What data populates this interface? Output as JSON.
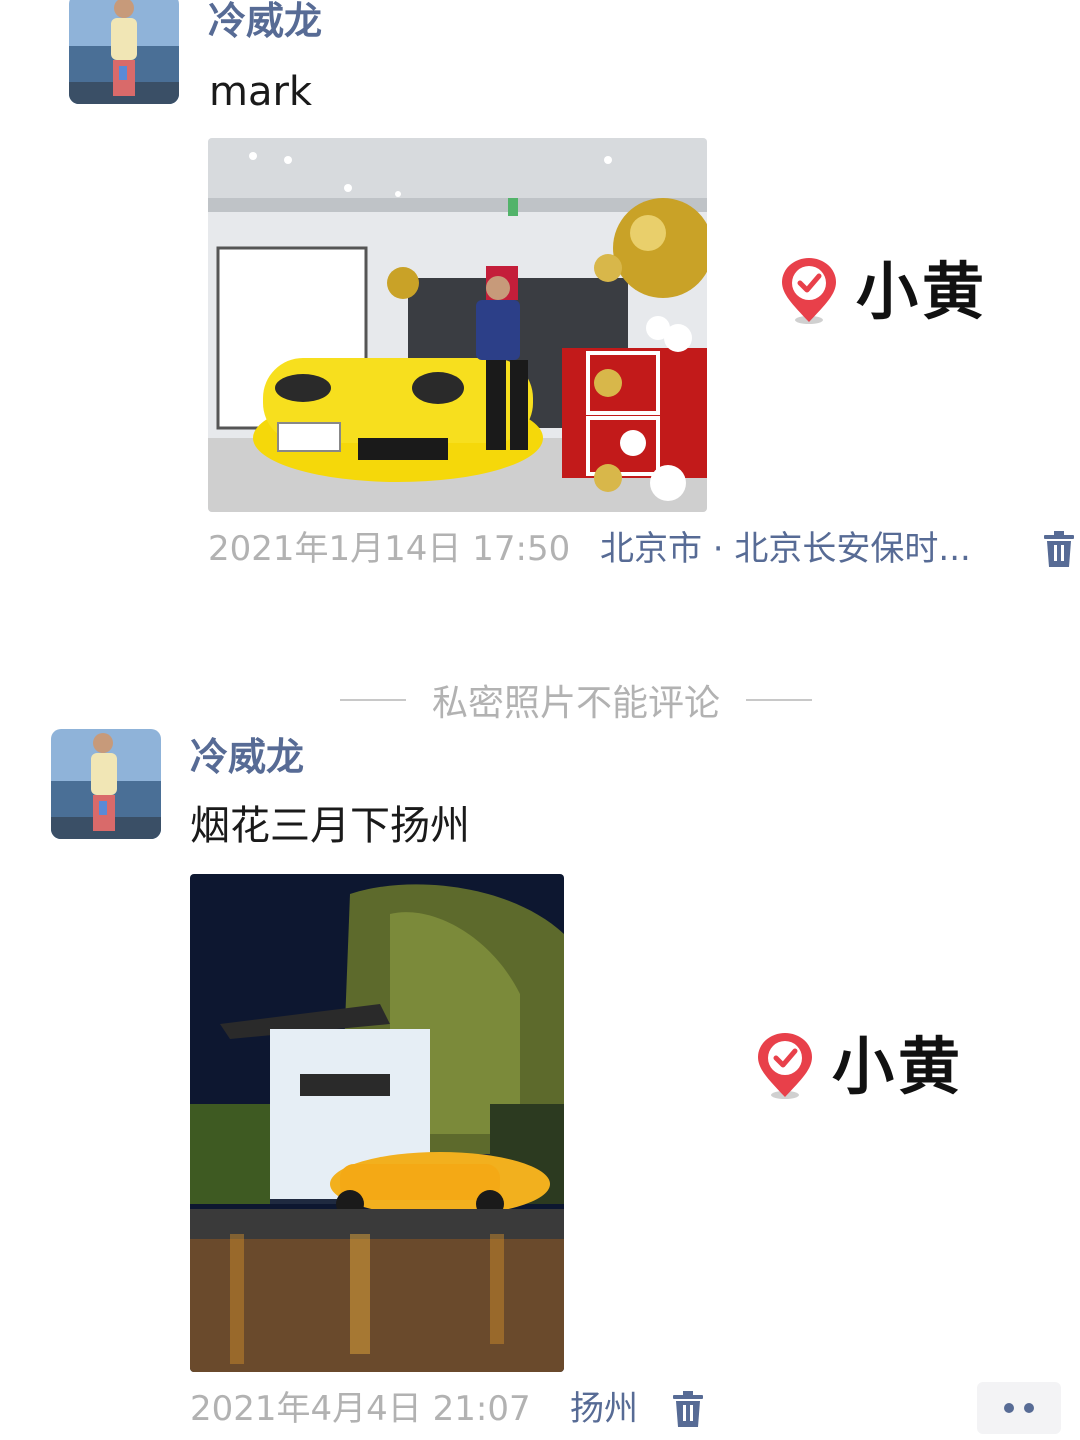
{
  "posts": [
    {
      "author": "冷威龙",
      "text": "mark",
      "timestamp": "2021年1月14日 17:50",
      "location": "北京市 · 北京长安保时...",
      "sticker_label": "小黄",
      "icons": {
        "avatar": "avatar-photo",
        "photo": "yellow-sports-car-showroom",
        "delete": "trash-icon",
        "sticker": "checkmark-pin-icon"
      }
    },
    {
      "author": "冷威龙",
      "text": "烟花三月下扬州",
      "timestamp": "2021年4月4日 21:07",
      "location": "扬州",
      "sticker_label": "小黄",
      "icons": {
        "avatar": "avatar-photo",
        "photo": "yellow-car-night-gate",
        "delete": "trash-icon",
        "sticker": "checkmark-pin-icon"
      }
    }
  ],
  "divider_text": "私密照片不能评论",
  "colors": {
    "link_blue": "#576b95",
    "meta_gray": "#b2b2b2",
    "sticker_red": "#e8404a"
  }
}
